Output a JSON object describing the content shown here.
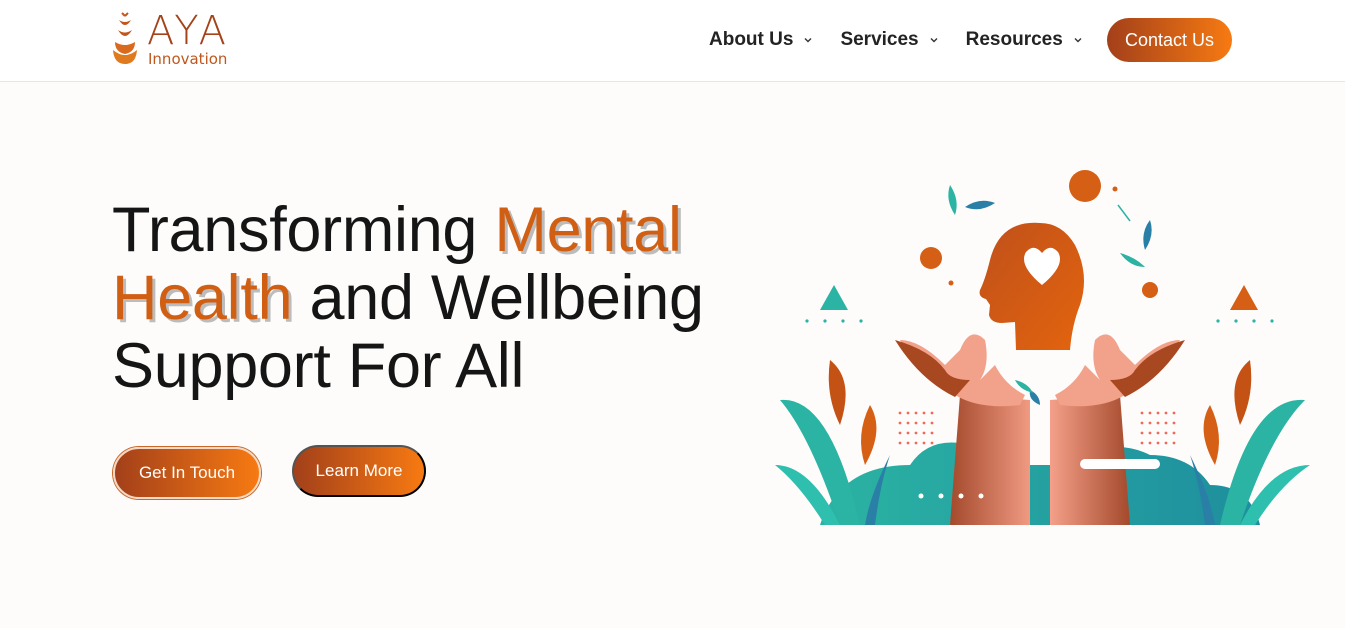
{
  "header": {
    "logo": {
      "title": "AYA",
      "subtitle": "Innovation",
      "icon": "wheat-sprout-icon"
    },
    "nav": [
      {
        "label": "About Us",
        "icon": "chevron-down-icon"
      },
      {
        "label": "Services",
        "icon": "chevron-down-icon"
      },
      {
        "label": "Resources",
        "icon": "chevron-down-icon"
      }
    ],
    "contact_label": "Contact Us"
  },
  "hero": {
    "title_part1": "Transforming ",
    "title_accent1": "Mental Health",
    "title_part2": " and Wellbeing Support For All",
    "primary_button": "Get In Touch",
    "secondary_button": "Learn More",
    "illustration": "hands-holding-head-with-heart"
  },
  "colors": {
    "accent": "#d05e13",
    "button_gradient_start": "#a3401a",
    "button_gradient_end": "#f77a12",
    "teal": "#2bb3a3",
    "background": "#fdfcfa"
  }
}
